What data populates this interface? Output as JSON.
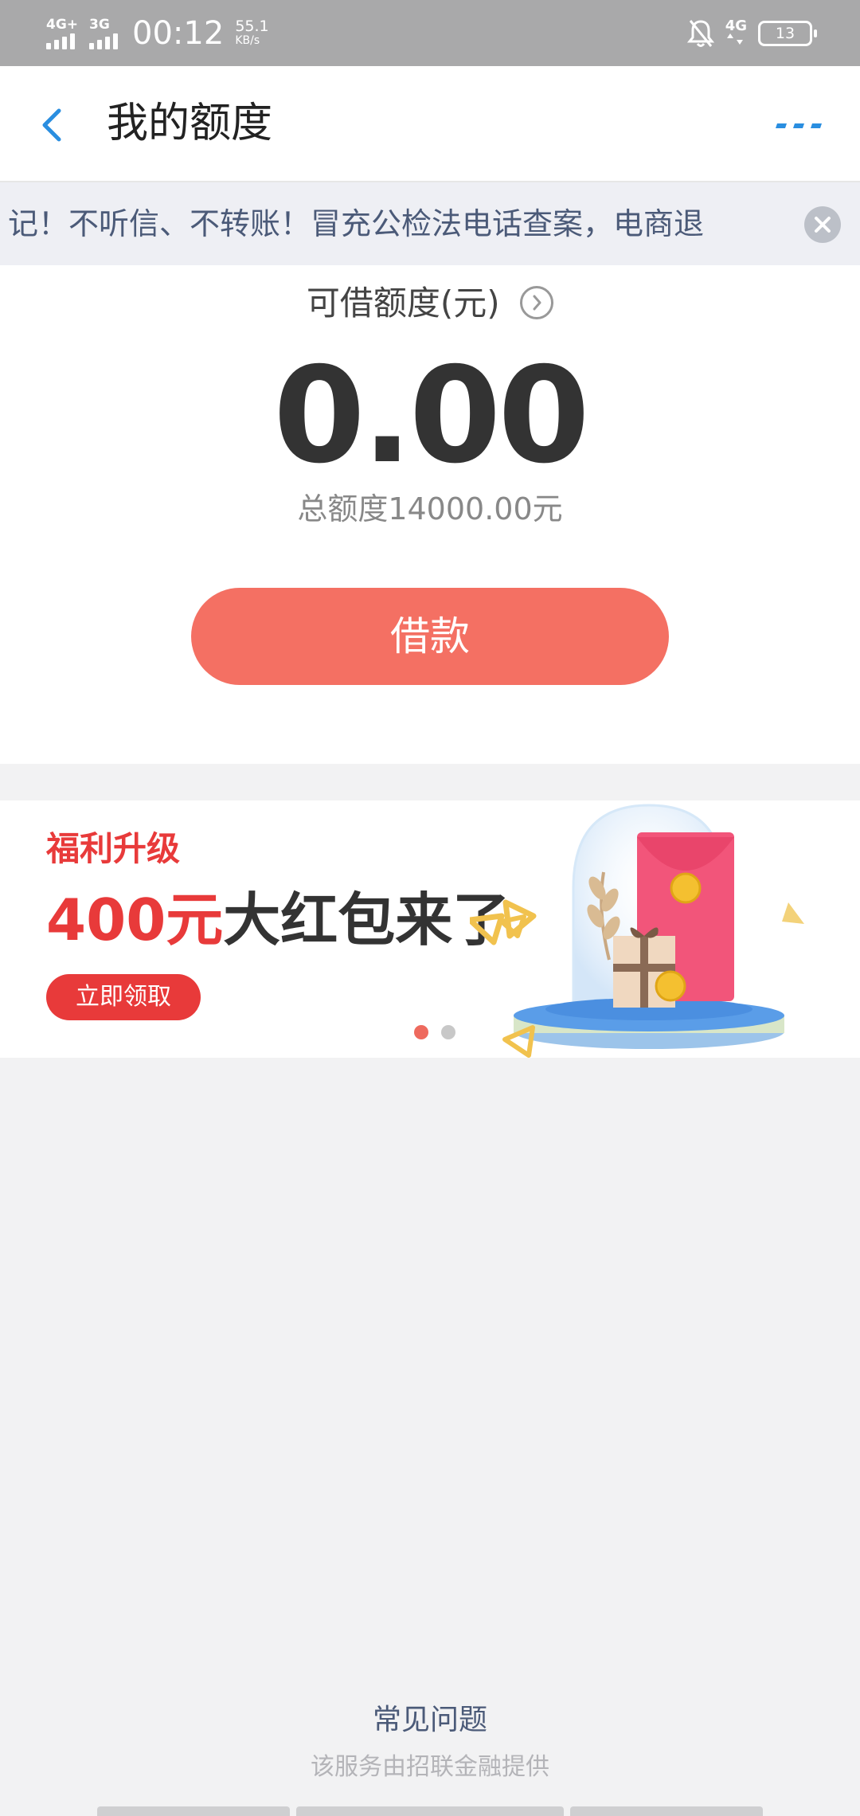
{
  "status_bar": {
    "signal1_label": "4G+",
    "signal2_label": "3G",
    "time": "00:12",
    "speed_value": "55.1",
    "speed_unit": "KB/s",
    "network_right": "4G",
    "battery": "13"
  },
  "header": {
    "title": "我的额度"
  },
  "notice": {
    "text": "记！不听信、不转账！冒充公检法电话查案，电商退"
  },
  "quota": {
    "label": "可借额度(元)",
    "amount": "0.00",
    "total": "总额度14000.00元",
    "borrow_button": "借款"
  },
  "banner": {
    "subtitle": "福利升级",
    "title_highlight": "400元",
    "title_rest": "大红包来了",
    "cta": "立即领取",
    "active_slide": 1,
    "slide_count": 2
  },
  "footer": {
    "faq": "常见问题",
    "provider": "该服务由招联金融提供"
  },
  "colors": {
    "accent_blue": "#2a8ee0",
    "borrow_button": "#f47063",
    "banner_red": "#e83a3a",
    "page_bg": "#f2f2f3"
  }
}
